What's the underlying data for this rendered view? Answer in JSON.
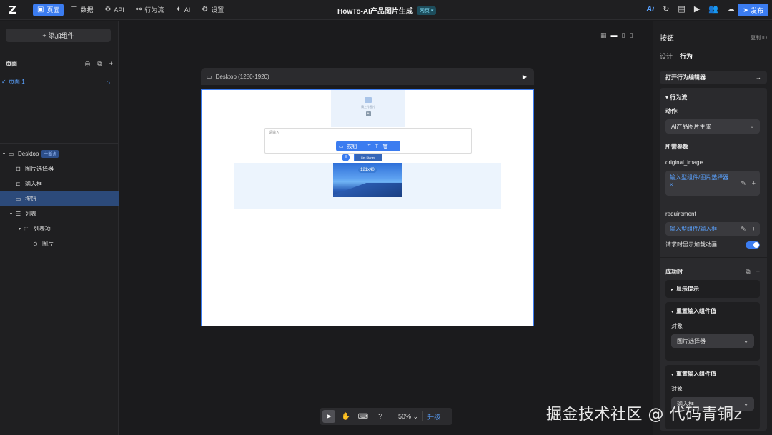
{
  "topbar": {
    "nav": [
      {
        "label": "页面",
        "icon": "page-icon",
        "active": true
      },
      {
        "label": "数据",
        "icon": "database-icon",
        "active": false
      },
      {
        "label": "API",
        "icon": "api-icon",
        "active": false
      },
      {
        "label": "行为流",
        "icon": "flow-icon",
        "active": false
      },
      {
        "label": "AI",
        "icon": "ai-icon",
        "active": false
      },
      {
        "label": "设置",
        "icon": "gear-icon",
        "active": false
      }
    ],
    "app_title": "HowTo-AI产品图片生成",
    "page_badge": "网页",
    "ai_label": "Ai",
    "publish_label": "发布"
  },
  "left": {
    "add_component": "添加组件",
    "pages_label": "页面",
    "page_name": "页面 1",
    "tree": [
      {
        "label": "Desktop",
        "badge": "主断点",
        "icon": "desktop-icon",
        "caret": "▾",
        "indent": 4
      },
      {
        "label": "图片选择器",
        "icon": "image-picker-icon",
        "caret": "",
        "indent": 22
      },
      {
        "label": "输入框",
        "icon": "input-icon",
        "caret": "",
        "indent": 22
      },
      {
        "label": "按钮",
        "icon": "button-icon",
        "caret": "",
        "indent": 22,
        "selected": true
      },
      {
        "label": "列表",
        "icon": "list-icon",
        "caret": "▾",
        "indent": 14
      },
      {
        "label": "列表项",
        "icon": "list-item-icon",
        "caret": "▾",
        "indent": 26
      },
      {
        "label": "图片",
        "icon": "image-icon",
        "caret": "",
        "indent": 46
      }
    ]
  },
  "canvas": {
    "frame_label": "Desktop (1280-1920)",
    "image_hint": "请上传图片",
    "textarea_placeholder": "请输入",
    "button_text": "Get Started",
    "selection_label": "按钮",
    "size_chip": "121x40",
    "zoom": "50%",
    "upgrade": "升级"
  },
  "right": {
    "title": "按钮",
    "copy_id": "复制 ID",
    "tabs": [
      {
        "label": "设计",
        "active": false
      },
      {
        "label": "行为",
        "active": true
      }
    ],
    "open_editor": "打开行为编辑器",
    "flow_title": "行为流",
    "action_label": "动作:",
    "action_value": "AI产品图片生成",
    "params_label": "所需参数",
    "param1_name": "original_image",
    "param1_value": "输入型组件/图片选择器",
    "param2_name": "requirement",
    "param2_value": "输入型组件/输入框",
    "loading_label": "请求时显示加载动画",
    "loading_on": true,
    "success_label": "成功时",
    "card1_title": "显示提示",
    "card2_title": "重置输入组件值",
    "card2_obj": "对象",
    "card2_value": "图片选择器",
    "card3_title": "重置输入组件值",
    "card3_obj": "对象",
    "card3_value": "输入框"
  },
  "watermark": "掘金技术社区 @ 代码青铜z",
  "colors": {
    "accent": "#3b7cf0",
    "bg": "#1b1b1d",
    "panel": "#1f1f21"
  }
}
